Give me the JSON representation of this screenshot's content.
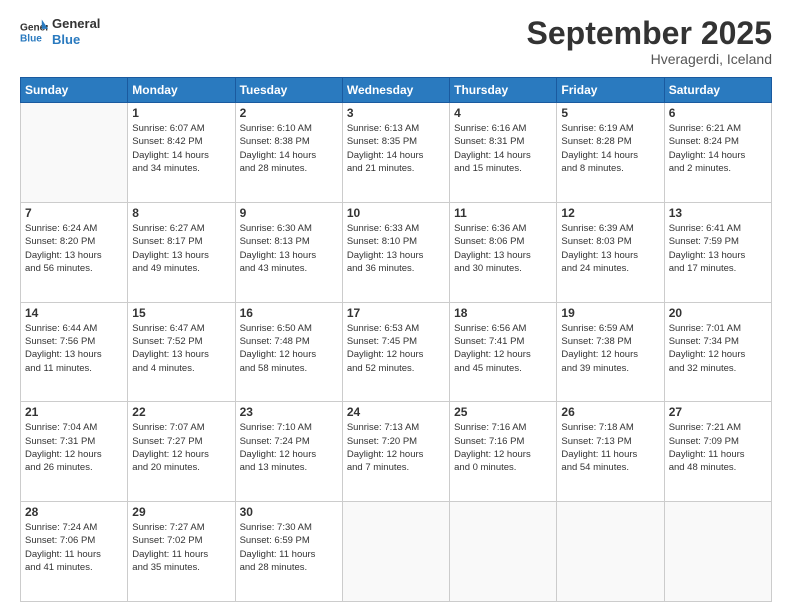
{
  "header": {
    "logo_general": "General",
    "logo_blue": "Blue",
    "month_title": "September 2025",
    "location": "Hveragerdi, Iceland"
  },
  "weekdays": [
    "Sunday",
    "Monday",
    "Tuesday",
    "Wednesday",
    "Thursday",
    "Friday",
    "Saturday"
  ],
  "weeks": [
    [
      {
        "day": "",
        "info": ""
      },
      {
        "day": "1",
        "info": "Sunrise: 6:07 AM\nSunset: 8:42 PM\nDaylight: 14 hours\nand 34 minutes."
      },
      {
        "day": "2",
        "info": "Sunrise: 6:10 AM\nSunset: 8:38 PM\nDaylight: 14 hours\nand 28 minutes."
      },
      {
        "day": "3",
        "info": "Sunrise: 6:13 AM\nSunset: 8:35 PM\nDaylight: 14 hours\nand 21 minutes."
      },
      {
        "day": "4",
        "info": "Sunrise: 6:16 AM\nSunset: 8:31 PM\nDaylight: 14 hours\nand 15 minutes."
      },
      {
        "day": "5",
        "info": "Sunrise: 6:19 AM\nSunset: 8:28 PM\nDaylight: 14 hours\nand 8 minutes."
      },
      {
        "day": "6",
        "info": "Sunrise: 6:21 AM\nSunset: 8:24 PM\nDaylight: 14 hours\nand 2 minutes."
      }
    ],
    [
      {
        "day": "7",
        "info": "Sunrise: 6:24 AM\nSunset: 8:20 PM\nDaylight: 13 hours\nand 56 minutes."
      },
      {
        "day": "8",
        "info": "Sunrise: 6:27 AM\nSunset: 8:17 PM\nDaylight: 13 hours\nand 49 minutes."
      },
      {
        "day": "9",
        "info": "Sunrise: 6:30 AM\nSunset: 8:13 PM\nDaylight: 13 hours\nand 43 minutes."
      },
      {
        "day": "10",
        "info": "Sunrise: 6:33 AM\nSunset: 8:10 PM\nDaylight: 13 hours\nand 36 minutes."
      },
      {
        "day": "11",
        "info": "Sunrise: 6:36 AM\nSunset: 8:06 PM\nDaylight: 13 hours\nand 30 minutes."
      },
      {
        "day": "12",
        "info": "Sunrise: 6:39 AM\nSunset: 8:03 PM\nDaylight: 13 hours\nand 24 minutes."
      },
      {
        "day": "13",
        "info": "Sunrise: 6:41 AM\nSunset: 7:59 PM\nDaylight: 13 hours\nand 17 minutes."
      }
    ],
    [
      {
        "day": "14",
        "info": "Sunrise: 6:44 AM\nSunset: 7:56 PM\nDaylight: 13 hours\nand 11 minutes."
      },
      {
        "day": "15",
        "info": "Sunrise: 6:47 AM\nSunset: 7:52 PM\nDaylight: 13 hours\nand 4 minutes."
      },
      {
        "day": "16",
        "info": "Sunrise: 6:50 AM\nSunset: 7:48 PM\nDaylight: 12 hours\nand 58 minutes."
      },
      {
        "day": "17",
        "info": "Sunrise: 6:53 AM\nSunset: 7:45 PM\nDaylight: 12 hours\nand 52 minutes."
      },
      {
        "day": "18",
        "info": "Sunrise: 6:56 AM\nSunset: 7:41 PM\nDaylight: 12 hours\nand 45 minutes."
      },
      {
        "day": "19",
        "info": "Sunrise: 6:59 AM\nSunset: 7:38 PM\nDaylight: 12 hours\nand 39 minutes."
      },
      {
        "day": "20",
        "info": "Sunrise: 7:01 AM\nSunset: 7:34 PM\nDaylight: 12 hours\nand 32 minutes."
      }
    ],
    [
      {
        "day": "21",
        "info": "Sunrise: 7:04 AM\nSunset: 7:31 PM\nDaylight: 12 hours\nand 26 minutes."
      },
      {
        "day": "22",
        "info": "Sunrise: 7:07 AM\nSunset: 7:27 PM\nDaylight: 12 hours\nand 20 minutes."
      },
      {
        "day": "23",
        "info": "Sunrise: 7:10 AM\nSunset: 7:24 PM\nDaylight: 12 hours\nand 13 minutes."
      },
      {
        "day": "24",
        "info": "Sunrise: 7:13 AM\nSunset: 7:20 PM\nDaylight: 12 hours\nand 7 minutes."
      },
      {
        "day": "25",
        "info": "Sunrise: 7:16 AM\nSunset: 7:16 PM\nDaylight: 12 hours\nand 0 minutes."
      },
      {
        "day": "26",
        "info": "Sunrise: 7:18 AM\nSunset: 7:13 PM\nDaylight: 11 hours\nand 54 minutes."
      },
      {
        "day": "27",
        "info": "Sunrise: 7:21 AM\nSunset: 7:09 PM\nDaylight: 11 hours\nand 48 minutes."
      }
    ],
    [
      {
        "day": "28",
        "info": "Sunrise: 7:24 AM\nSunset: 7:06 PM\nDaylight: 11 hours\nand 41 minutes."
      },
      {
        "day": "29",
        "info": "Sunrise: 7:27 AM\nSunset: 7:02 PM\nDaylight: 11 hours\nand 35 minutes."
      },
      {
        "day": "30",
        "info": "Sunrise: 7:30 AM\nSunset: 6:59 PM\nDaylight: 11 hours\nand 28 minutes."
      },
      {
        "day": "",
        "info": ""
      },
      {
        "day": "",
        "info": ""
      },
      {
        "day": "",
        "info": ""
      },
      {
        "day": "",
        "info": ""
      }
    ]
  ]
}
